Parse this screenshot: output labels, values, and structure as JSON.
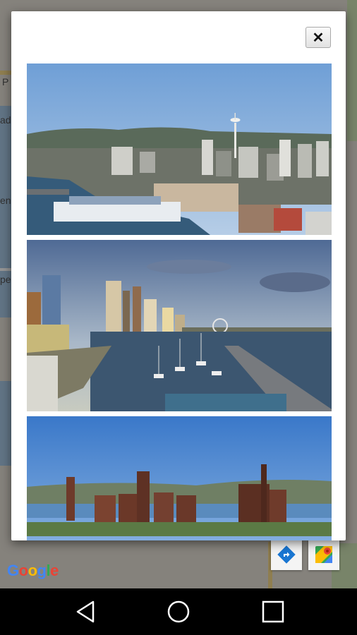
{
  "dialog": {
    "close_label": "✕"
  },
  "map": {
    "labels": [
      "P",
      "ad",
      "ene",
      "pe"
    ],
    "logo": [
      "G",
      "o",
      "o",
      "g",
      "l",
      "e"
    ]
  },
  "photos": [
    {
      "subject": "Seattle skyline with Space Needle and Pier 66"
    },
    {
      "subject": "Seattle waterfront marina and downtown skyline"
    },
    {
      "subject": "Gas Works Park industrial towers"
    }
  ],
  "icons": {
    "close": "close-icon",
    "directions": "directions-icon",
    "maps": "google-maps-icon",
    "back": "back-icon",
    "home": "home-icon",
    "recents": "recents-icon"
  },
  "colors": {
    "accent_blue": "#1976d2",
    "maps_blue": "#4285f4"
  }
}
